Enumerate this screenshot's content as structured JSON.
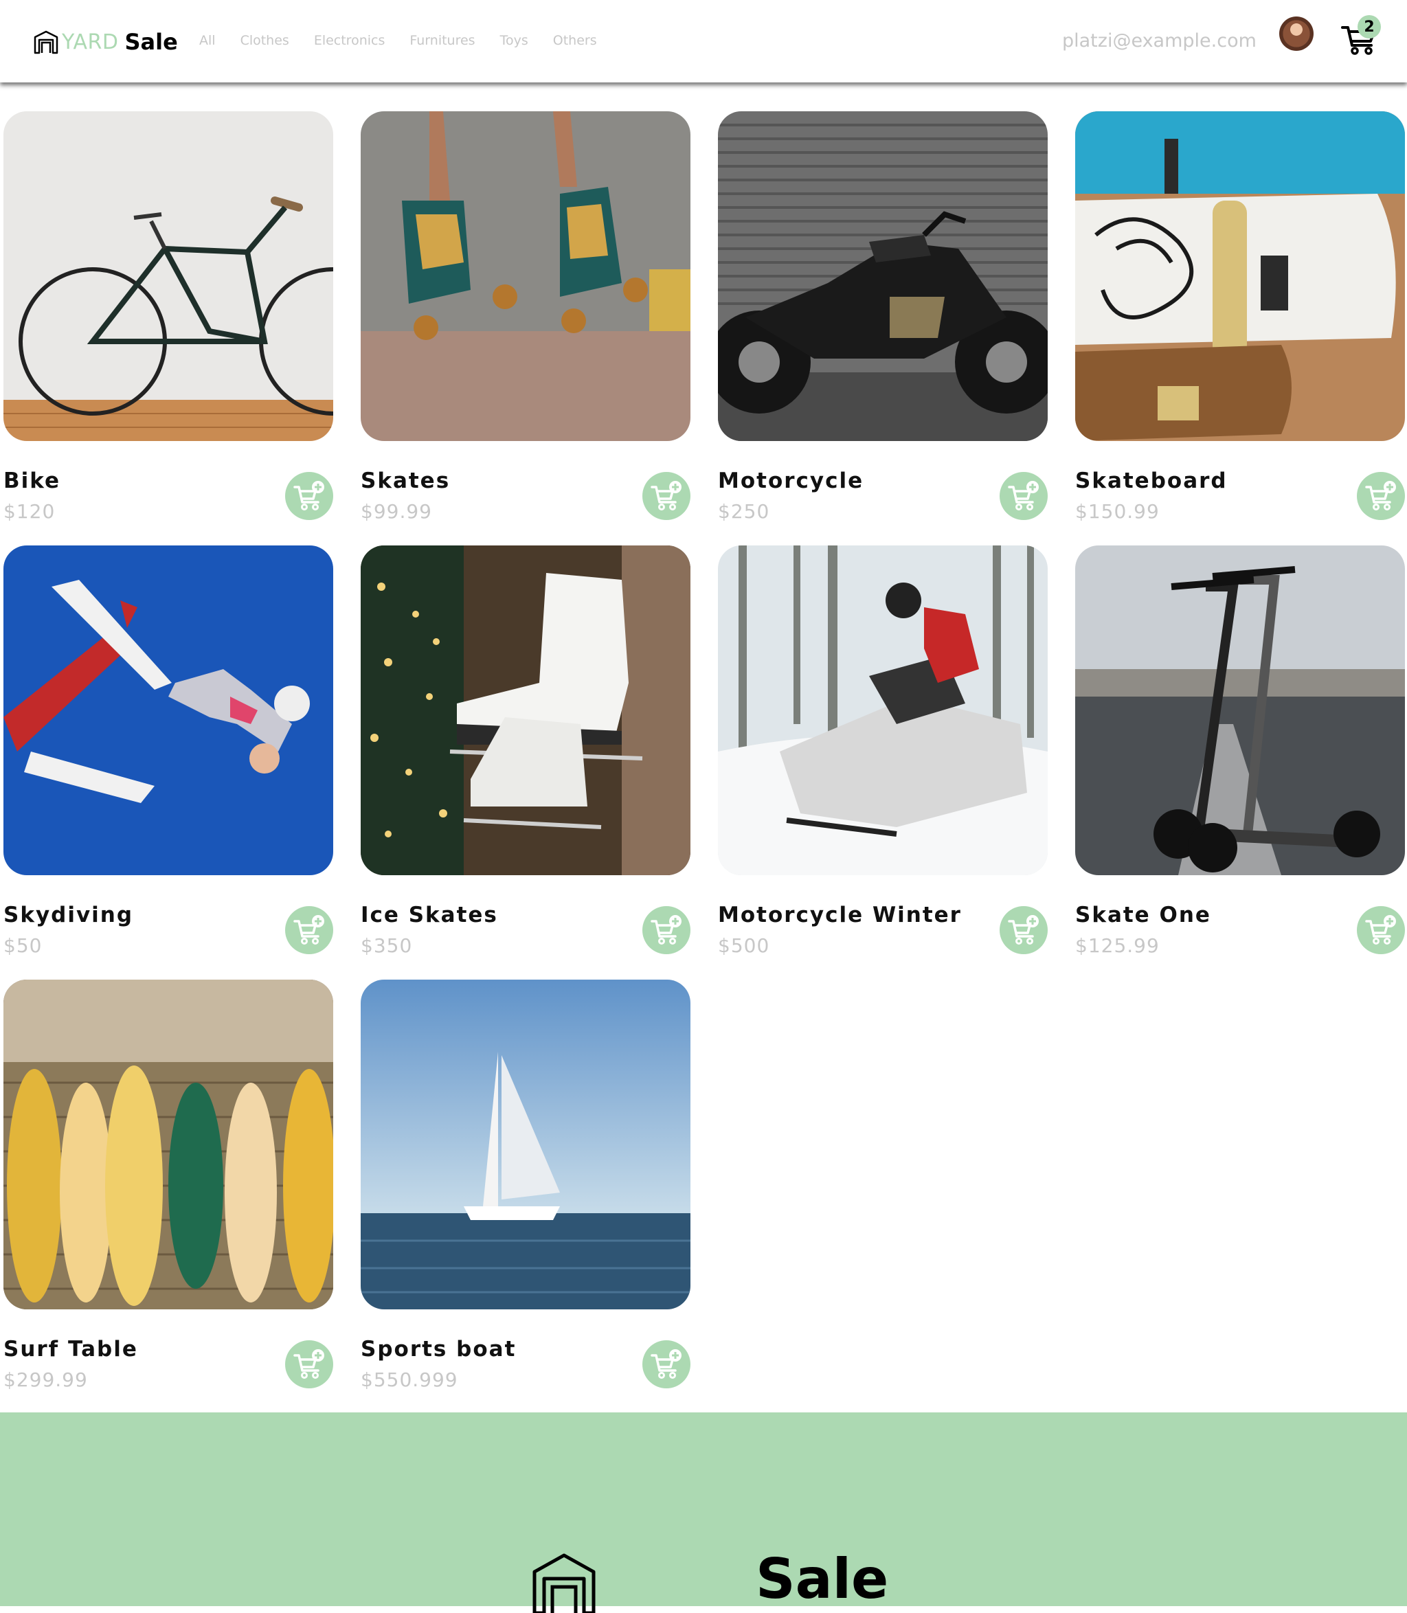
{
  "nav": {
    "brand_yard": "YARD",
    "brand_sale": "Sale",
    "categories": [
      "All",
      "Clothes",
      "Electronics",
      "Furnitures",
      "Toys",
      "Others"
    ],
    "email": "platzi@example.com",
    "cart_count": "2"
  },
  "products": [
    {
      "name": "Bike",
      "price": "$120",
      "image": "bicycle"
    },
    {
      "name": "Skates",
      "price": "$99.99",
      "image": "roller-skates"
    },
    {
      "name": "Motorcycle",
      "price": "$250",
      "image": "motorcycle"
    },
    {
      "name": "Skateboard",
      "price": "$150.99",
      "image": "skateboards"
    },
    {
      "name": "Skydiving",
      "price": "$50",
      "image": "skydiver-and-plane"
    },
    {
      "name": "Ice Skates",
      "price": "$350",
      "image": "ice-skates"
    },
    {
      "name": "Motorcycle Winter",
      "price": "$500",
      "image": "snowmobile"
    },
    {
      "name": "Skate One",
      "price": "$125.99",
      "image": "electric-scooters"
    },
    {
      "name": "Surf Table",
      "price": "$299.99",
      "image": "surfboards"
    },
    {
      "name": "Sports boat",
      "price": "$550.999",
      "image": "sailboat"
    }
  ],
  "footer": {
    "brand_sale": "Sale"
  },
  "colors": {
    "accent": "#acd9b2",
    "muted_text": "#c7c7c7"
  }
}
